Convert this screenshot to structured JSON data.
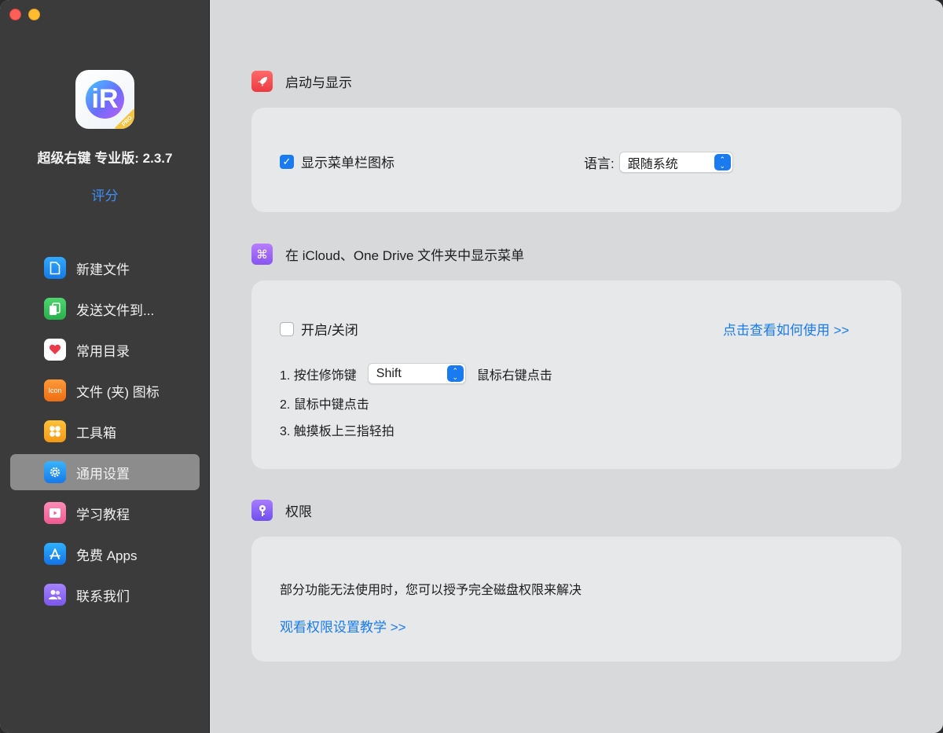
{
  "app": {
    "name": "超级右键 专业版: 2.3.7",
    "rate_label": "评分",
    "icon_letter": "iR",
    "icon_badge": "PRO"
  },
  "sidebar": {
    "items": [
      {
        "label": "新建文件",
        "icon": "file-icon",
        "color": "#1e90ff"
      },
      {
        "label": "发送文件到...",
        "icon": "copy-file-icon",
        "color": "#33c25a"
      },
      {
        "label": "常用目录",
        "icon": "heart-icon",
        "color": "#ffffff"
      },
      {
        "label": "文件 (夹) 图标",
        "icon": "icon-text-icon",
        "color": "#f08a24"
      },
      {
        "label": "工具箱",
        "icon": "clover-icon",
        "color": "#f3a51f"
      },
      {
        "label": "通用设置",
        "icon": "gear-icon",
        "color": "#1c8ef0",
        "active": true
      },
      {
        "label": "学习教程",
        "icon": "video-icon",
        "color": "#f56fa0"
      },
      {
        "label": "免费 Apps",
        "icon": "app-store-icon",
        "color": "#1a8cf0"
      },
      {
        "label": "联系我们",
        "icon": "people-icon",
        "color": "#8e6af0"
      }
    ]
  },
  "sections": {
    "launch": {
      "title": "启动与显示",
      "icon": "rocket-icon",
      "show_menubar_label": "显示菜单栏图标",
      "show_menubar_checked": true,
      "language_label": "语言:",
      "language_value": "跟随系统"
    },
    "icloud": {
      "title": "在 iCloud、One Drive 文件夹中显示菜单",
      "icon": "command-icon",
      "toggle_label": "开启/关闭",
      "toggle_checked": false,
      "howto_link": "点击查看如何使用 >>",
      "step1_prefix": "1. 按住修饰键",
      "modifier_value": "Shift",
      "step1_suffix": "鼠标右键点击",
      "step2": "2. 鼠标中键点击",
      "step3": "3. 触摸板上三指轻拍"
    },
    "permission": {
      "title": "权限",
      "icon": "key-icon",
      "description": "部分功能无法使用时，您可以授予完全磁盘权限来解决",
      "tutorial_link": "观看权限设置教学 >>"
    }
  }
}
